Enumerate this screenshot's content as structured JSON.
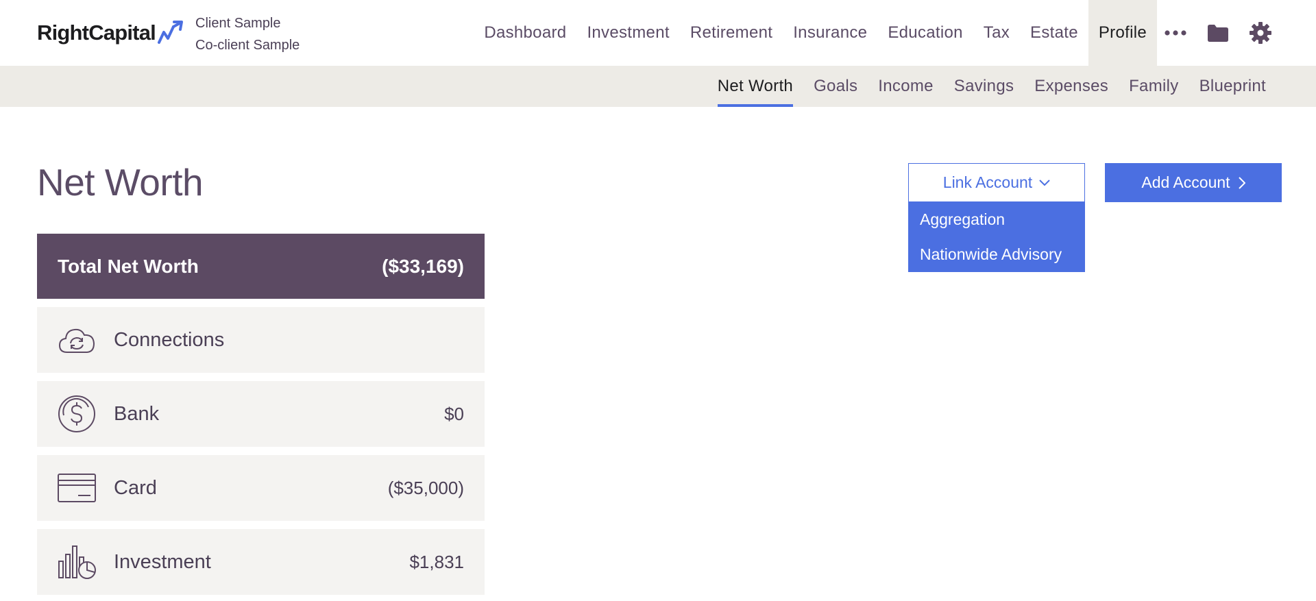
{
  "brand": {
    "name": "RightCapital"
  },
  "clients": {
    "client": "Client Sample",
    "co_client": "Co-client Sample"
  },
  "main_nav": {
    "items": [
      "Dashboard",
      "Investment",
      "Retirement",
      "Insurance",
      "Education",
      "Tax",
      "Estate",
      "Profile"
    ],
    "active": "Profile"
  },
  "icons": {
    "more": "more-dots-icon",
    "vault": "folder-icon",
    "settings": "gear-icon"
  },
  "sub_nav": {
    "items": [
      "Net Worth",
      "Goals",
      "Income",
      "Savings",
      "Expenses",
      "Family",
      "Blueprint"
    ],
    "active": "Net Worth"
  },
  "page": {
    "title": "Net Worth"
  },
  "link_account": {
    "label": "Link Account",
    "options": [
      "Aggregation",
      "Nationwide Advisory"
    ]
  },
  "add_account": {
    "label": "Add Account"
  },
  "total_net_worth": {
    "label": "Total Net Worth",
    "value": "($33,169)"
  },
  "accounts": [
    {
      "label": "Connections",
      "value": "",
      "icon": "cloud-sync-icon"
    },
    {
      "label": "Bank",
      "value": "$0",
      "icon": "dollar-coin-icon"
    },
    {
      "label": "Card",
      "value": "($35,000)",
      "icon": "credit-card-icon"
    },
    {
      "label": "Investment",
      "value": "$1,831",
      "icon": "chart-pie-icon"
    }
  ],
  "colors": {
    "accent": "#4b6fe1",
    "header_purple": "#5c4a63",
    "row_bg": "#f4f3f1",
    "subnav_bg": "#edebe6",
    "text": "#4a3f55"
  }
}
